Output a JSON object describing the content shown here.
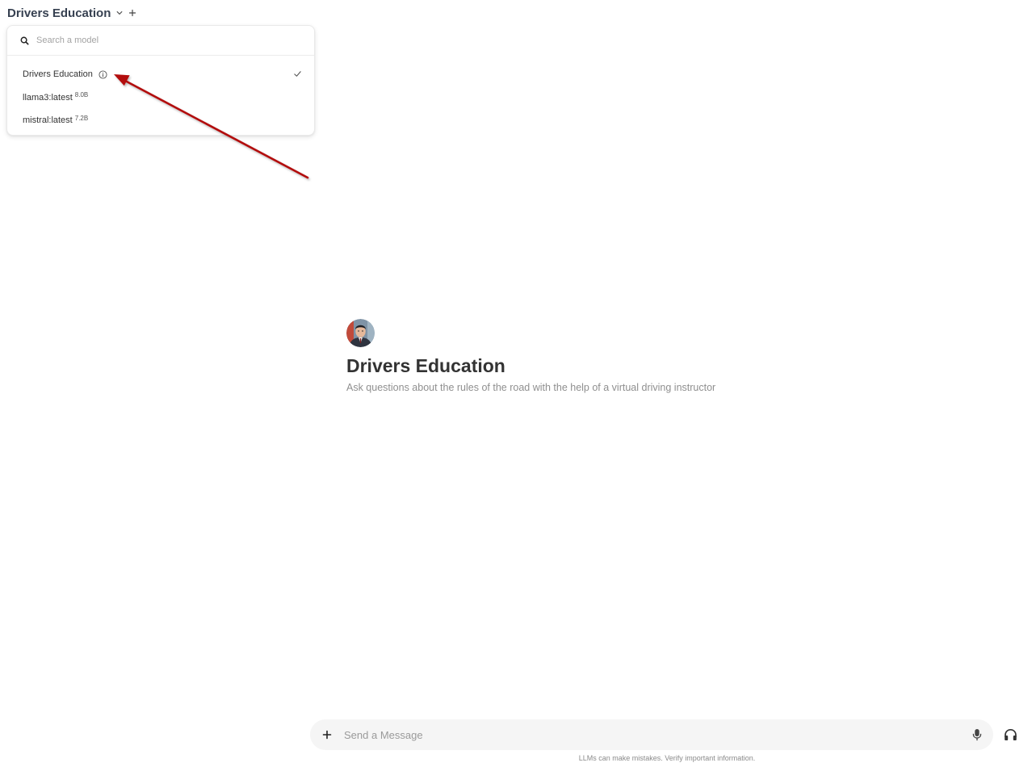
{
  "header": {
    "selected_model": "Drivers Education",
    "chevron_icon": "chevron-down-icon",
    "add_icon": "plus-icon"
  },
  "model_dropdown": {
    "search_placeholder": "Search a model",
    "search_value": "",
    "items": [
      {
        "label": "Drivers Education",
        "size": "",
        "selected": true,
        "has_info_icon": true
      },
      {
        "label": "llama3:latest",
        "size": "8.0B",
        "selected": false,
        "has_info_icon": false
      },
      {
        "label": "mistral:latest",
        "size": "7.2B",
        "selected": false,
        "has_info_icon": false
      }
    ]
  },
  "welcome": {
    "avatar_icon": "avatar",
    "title": "Drivers Education",
    "description": "Ask questions about the rules of the road with the help of a virtual driving instructor"
  },
  "composer": {
    "placeholder": "Send a Message",
    "value": "",
    "plus_icon": "plus-icon",
    "mic_icon": "microphone-icon",
    "headphones_icon": "headphones-icon"
  },
  "footer": {
    "disclaimer": "LLMs can make mistakes. Verify important information."
  },
  "annotation": {
    "arrow_color": "#b20a0a"
  }
}
